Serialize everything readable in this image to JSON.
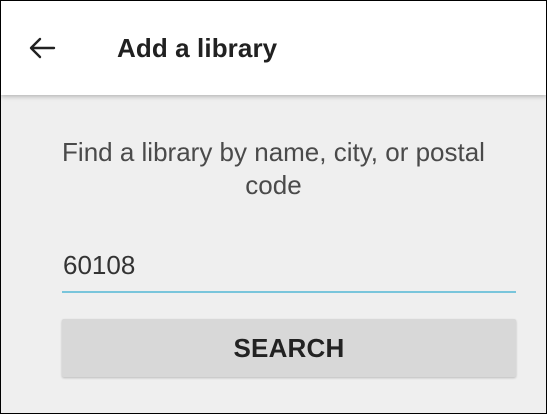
{
  "header": {
    "back_icon": "arrow-left-icon",
    "title": "Add a library"
  },
  "main": {
    "prompt": "Find a library by name, city, or postal code",
    "search": {
      "value": "60108",
      "placeholder": ""
    },
    "search_button_label": "SEARCH"
  },
  "colors": {
    "background": "#efefef",
    "toolbar": "#ffffff",
    "accent_underline": "#79c5db",
    "button": "#d8d8d8",
    "title_text": "#212121"
  }
}
